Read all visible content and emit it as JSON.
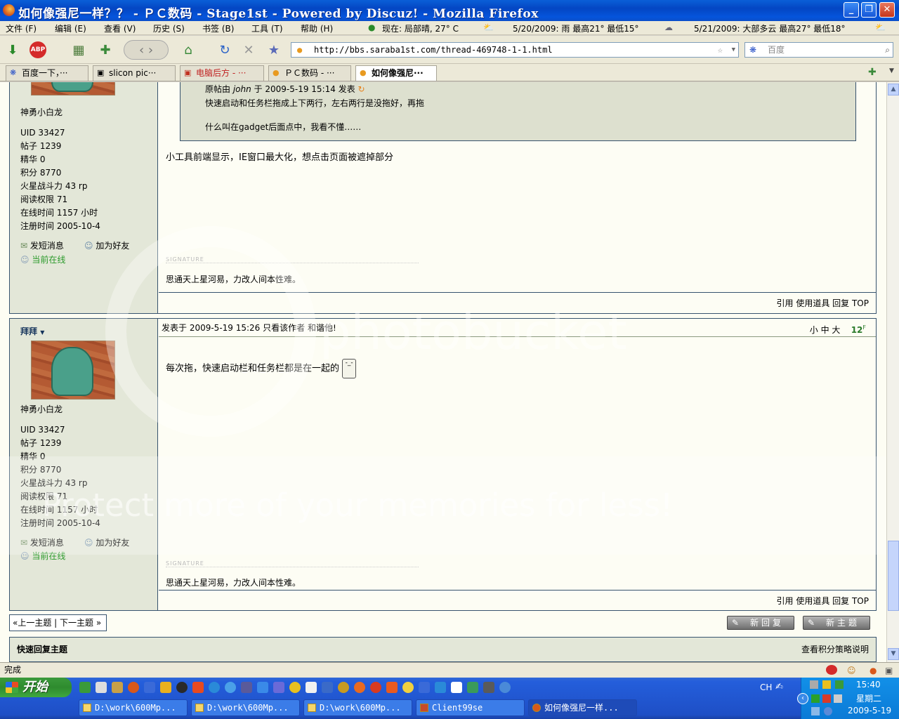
{
  "window": {
    "title": "如何像强尼一样？？ - ＰＣ数码 - Stage1st - Powered by Discuz! - Mozilla Firefox"
  },
  "menu": {
    "items": [
      "文件 (F)",
      "编辑 (E)",
      "查看 (V)",
      "历史 (S)",
      "书签 (B)",
      "工具 (T)",
      "帮助 (H)"
    ],
    "weather_now": "现在: 局部晴, 27° C",
    "weather_d1": "5/20/2009: 雨  最高21°  最低15°",
    "weather_d2": "5/21/2009: 大部多云  最高27°  最低18°"
  },
  "toolbar": {
    "url": "http://bbs.saraba1st.com/thread-469748-1-1.html",
    "search_placeholder": "百度"
  },
  "tabs": [
    {
      "label": "百度一下，···"
    },
    {
      "label": "slicon pic···"
    },
    {
      "label": "电脑后方 - ···"
    },
    {
      "label": "ＰＣ数码 - ···"
    },
    {
      "label": "如何像强尼···"
    }
  ],
  "post1": {
    "username": "神勇小白龙",
    "stats": [
      "UID  33427",
      "帖子  1239",
      "精华  0",
      "积分  8770",
      "火星战斗力  43 rp",
      "阅读权限  71",
      "在线时间  1157 小时",
      "注册时间  2005-10-4"
    ],
    "send_msg": "发短消息",
    "add_friend": "加为好友",
    "online": "当前在线",
    "quote_head_prefix": "原帖由",
    "quote_author": "john",
    "quote_head_suffix": "于 2009-5-19 15:14 发表",
    "quote_line1": "快速启动和任务栏拖成上下两行，左右两行是没拖好，再拖",
    "quote_line2": "什么叫在gadget后面点中，我看不懂……",
    "body": "小工具前端显示，IE窗口最大化，想点击页面被遮掉部分",
    "sig_label": "SIGNATURE",
    "signature": "思通天上星河易，力改人间本性难。",
    "actions": "引用  使用道具  回复  TOP"
  },
  "post2": {
    "poster_name": "拜拜",
    "username": "神勇小白龙",
    "stats": [
      "UID  33427",
      "帖子  1239",
      "精华  0",
      "积分  8770",
      "火星战斗力  43 rp",
      "阅读权限  71",
      "在线时间  1157 小时",
      "注册时间  2005-10-4"
    ],
    "send_msg": "发短消息",
    "add_friend": "加为好友",
    "online": "当前在线",
    "header": "发表于 2009-5-19 15:26  只看该作者  和谐他!",
    "font_sizes": "小  中  大",
    "floor": "12",
    "floor_sup": "F",
    "body": "每次拖，快速启动栏和任务栏都是在一起的",
    "sig_label": "SIGNATURE",
    "signature": "思通天上星河易，力改人间本性难。",
    "actions": "引用  使用道具  回复  TOP"
  },
  "nav": {
    "prev_next": "«上一主题 | 下一主题 »",
    "new_reply": "新回复",
    "new_topic": "新主题"
  },
  "quick_reply": {
    "title": "快速回复主题",
    "link": "查看积分策略说明"
  },
  "status": {
    "text": "完成"
  },
  "taskbar": {
    "start": "开始",
    "tasks": [
      "D:\\work\\600Mp...",
      "D:\\work\\600Mp...",
      "D:\\work\\600Mp...",
      "Client99se",
      "如何像强尼一样..."
    ],
    "lang": "CH",
    "time": "15:40",
    "weekday": "星期二",
    "date": "2009-5-19"
  },
  "watermark": {
    "line1": "photobucket",
    "line2": "Protect more of your memories for less!"
  }
}
